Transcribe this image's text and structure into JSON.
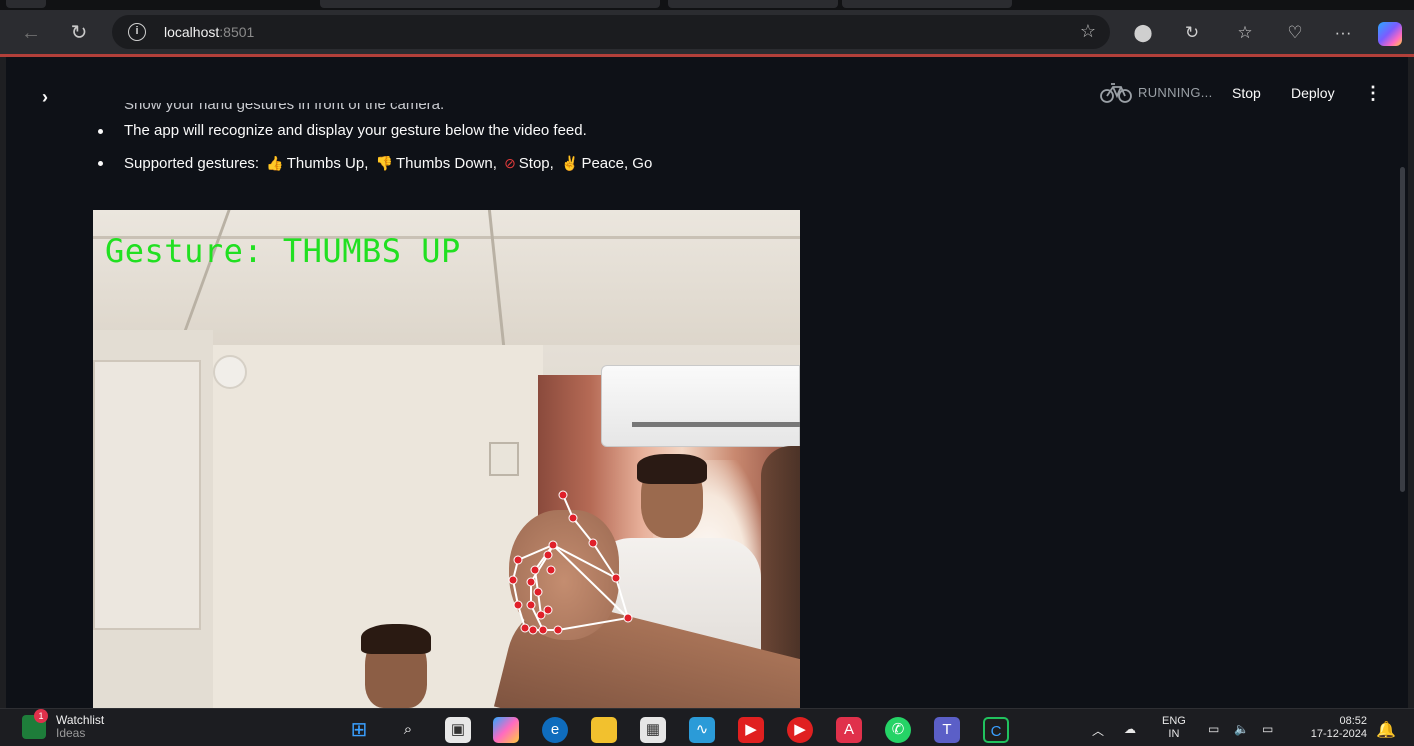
{
  "browser": {
    "address": {
      "host": "localhost",
      "port": ":8501"
    }
  },
  "app": {
    "status_text": "RUNNING...",
    "stop_label": "Stop",
    "deploy_label": "Deploy",
    "instructions": {
      "partial_line": "Show your hand gestures in front of the camera.",
      "line_recognize": "The app will recognize and display your gesture below the video feed.",
      "supported_prefix": "Supported gestures:",
      "gestures": [
        {
          "icon": "thumbs-up-icon",
          "glyph": "👍",
          "label": "Thumbs Up,"
        },
        {
          "icon": "thumbs-down-icon",
          "glyph": "👎",
          "label": "Thumbs Down,"
        },
        {
          "icon": "stop-icon",
          "glyph": "⊘",
          "label": "Stop,"
        },
        {
          "icon": "peace-icon",
          "glyph": "✌",
          "label": "Peace, Go"
        }
      ]
    },
    "video": {
      "gesture_overlay": "Gesture: THUMBS UP",
      "overlay_color": "#21e021",
      "landmark_color": "#e0202a"
    }
  },
  "taskbar": {
    "widget_label": "Watchlist",
    "widget_sub": "Ideas",
    "widget_badge": "1",
    "lang": "ENG",
    "lang_sub": "IN",
    "time": "08:52",
    "date": "17-12-2024"
  },
  "colors": {
    "app_bg": "#0e1117",
    "browser_accent_line": "#b3403a"
  }
}
